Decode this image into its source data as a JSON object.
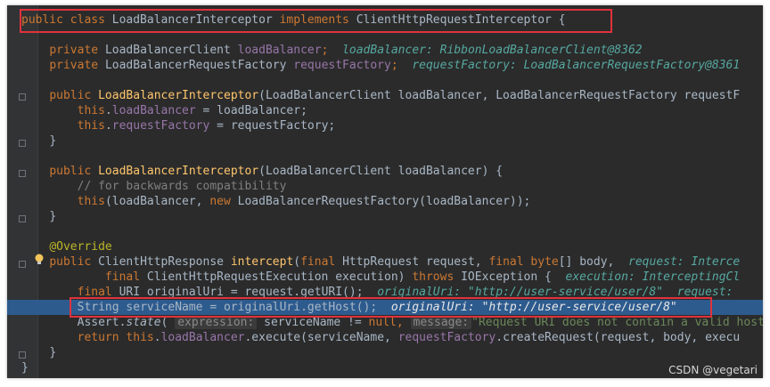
{
  "code": {
    "line1": {
      "kw": "public class",
      "name": "LoadBalancerInterceptor",
      "impl": "implements",
      "iface": "ClientHttpRequestInterceptor {"
    },
    "line2": {
      "kw": "private",
      "type": "LoadBalancerClient",
      "field": "loadBalancer",
      "semi": ";",
      "hint": "loadBalancer: RibbonLoadBalancerClient@8362"
    },
    "line3": {
      "kw": "private",
      "type": "LoadBalancerRequestFactory",
      "field": "requestFactory",
      "semi": ";",
      "hint": "requestFactory: LoadBalancerRequestFactory@8361"
    },
    "line4": {
      "kw": "public",
      "name": "LoadBalancerInterceptor",
      "params": "(LoadBalancerClient loadBalancer,",
      "rest": "LoadBalancerRequestFactory requestF"
    },
    "line5": {
      "this": "this",
      "field": "loadBalancer",
      "rest": " = loadBalancer;"
    },
    "line6": {
      "this": "this",
      "field": "requestFactory",
      "rest": " = requestFactory;"
    },
    "line7": {
      "brace": "}"
    },
    "line8": {
      "kw": "public",
      "name": "LoadBalancerInterceptor",
      "params": "(LoadBalancerClient loadBalancer) {"
    },
    "line9": {
      "comment": "// for backwards compatibility"
    },
    "line10": {
      "this": "this",
      "a": "(loadBalancer,",
      "new": "new",
      "b": "LoadBalancerRequestFactory(loadBalancer));"
    },
    "line11": {
      "brace": "}"
    },
    "line12": {
      "annotation": "@Override"
    },
    "line13": {
      "kw": "public",
      "type": "ClientHttpResponse",
      "name": "intercept",
      "p1": "(",
      "final1": "final",
      "p2": "HttpRequest request,",
      "final2": "final",
      "byte": "byte",
      "p3": "[] body,",
      "hint": "request: Interce"
    },
    "line14": {
      "final": "final",
      "p": "ClientHttpRequestExecution execution)",
      "throws": "throws",
      "ex": "IOException {",
      "hint": "execution: InterceptingCl"
    },
    "line15": {
      "final": "final",
      "p": "URI originalUri = request.getURI();",
      "hint": "originalUri: \"http://user-service/user/8\"",
      "hint2": "request:"
    },
    "line16": {
      "p": "String serviceName = originalUri.getHost();",
      "hint": "originalUri: \"http://user-service/user/8\""
    },
    "line17": {
      "a": "Assert.",
      "state": "state",
      "b": "(",
      "ph1": "expression:",
      "c": " serviceName != ",
      "null": "null",
      "d": ",",
      "ph2": "message:",
      "str": "\"Request URI does not contain a valid host"
    },
    "line18": {
      "ret": "return",
      "this": "this",
      "dot": ".",
      "field": "loadBalancer",
      "a": ".execute(serviceName,",
      "field2": "requestFactory",
      "b": ".createRequest(request, body, execu"
    },
    "line19": {
      "brace": "}"
    },
    "line20": {
      "brace": "}"
    }
  },
  "watermark": "CSDN @vegetari",
  "colors": {
    "highlight": "#2d5b8e",
    "annotationBox": "#e0323c",
    "keyword": "#cc7832"
  },
  "icons": {
    "bulb": "lightbulb-icon",
    "breakpoint": "breakpoint-icon"
  }
}
